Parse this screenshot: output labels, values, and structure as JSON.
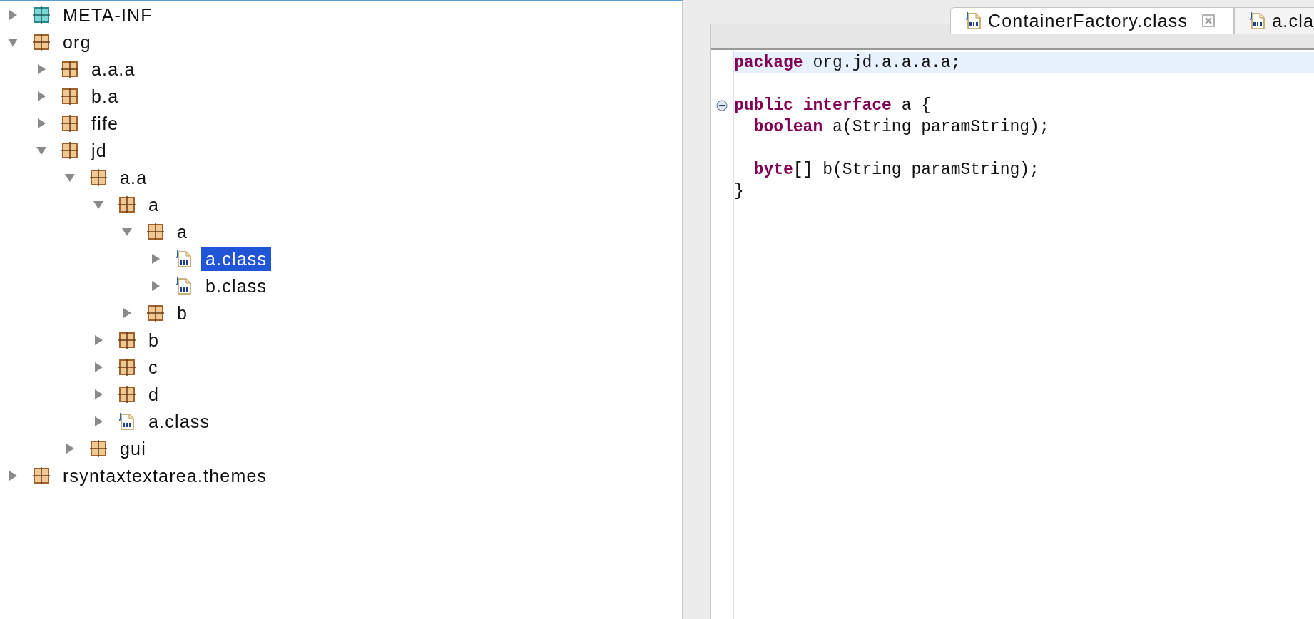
{
  "tree": [
    {
      "label": "META-INF",
      "kind": "folder",
      "expanded": false,
      "selected": false
    },
    {
      "label": "org",
      "kind": "package",
      "expanded": true,
      "selected": false,
      "children": [
        {
          "label": "a.a.a",
          "kind": "package",
          "expanded": false,
          "selected": false
        },
        {
          "label": "b.a",
          "kind": "package",
          "expanded": false,
          "selected": false
        },
        {
          "label": "fife",
          "kind": "package",
          "expanded": false,
          "selected": false
        },
        {
          "label": "jd",
          "kind": "package",
          "expanded": true,
          "selected": false,
          "children": [
            {
              "label": "a.a",
              "kind": "package",
              "expanded": true,
              "selected": false,
              "children": [
                {
                  "label": "a",
                  "kind": "package",
                  "expanded": true,
                  "selected": false,
                  "children": [
                    {
                      "label": "a",
                      "kind": "package",
                      "expanded": true,
                      "selected": false,
                      "children": [
                        {
                          "label": "a.class",
                          "kind": "class",
                          "expanded": false,
                          "selected": true
                        },
                        {
                          "label": "b.class",
                          "kind": "class",
                          "expanded": false,
                          "selected": false
                        }
                      ]
                    },
                    {
                      "label": "b",
                      "kind": "package",
                      "expanded": false,
                      "selected": false
                    }
                  ]
                },
                {
                  "label": "b",
                  "kind": "package",
                  "expanded": false,
                  "selected": false
                },
                {
                  "label": "c",
                  "kind": "package",
                  "expanded": false,
                  "selected": false
                },
                {
                  "label": "d",
                  "kind": "package",
                  "expanded": false,
                  "selected": false
                },
                {
                  "label": "a.class",
                  "kind": "class",
                  "expanded": false,
                  "selected": false
                }
              ]
            },
            {
              "label": "gui",
              "kind": "package",
              "expanded": false,
              "selected": false
            }
          ]
        }
      ]
    },
    {
      "label": "rsyntaxtextarea.themes",
      "kind": "package",
      "expanded": false,
      "selected": false
    }
  ],
  "editor_tabs": [
    {
      "label": "ContainerFactory.class",
      "selected": true
    },
    {
      "label": "a.cla",
      "selected": false
    }
  ],
  "editor": {
    "lines": [
      {
        "kind": "code",
        "tokens": [
          {
            "text": "package",
            "kind": "keyword"
          },
          {
            "text": " org.jd.a.a.a.a;",
            "kind": "plain"
          }
        ],
        "current": true
      },
      {
        "kind": "blank"
      },
      {
        "kind": "code",
        "tokens": [
          {
            "text": "public",
            "kind": "keyword"
          },
          {
            "text": " interface",
            "kind": "keyword"
          },
          {
            "text": " a {",
            "kind": "plain"
          }
        ],
        "foldable": true
      },
      {
        "kind": "code",
        "tokens": [
          {
            "text": "  boolean",
            "kind": "keyword"
          },
          {
            "text": " a(String paramString);",
            "kind": "plain"
          }
        ]
      },
      {
        "kind": "blank"
      },
      {
        "kind": "code",
        "tokens": [
          {
            "text": "  byte",
            "kind": "keyword"
          },
          {
            "text": "[] b(String paramString);",
            "kind": "plain"
          }
        ]
      },
      {
        "kind": "code",
        "tokens": [
          {
            "text": "}",
            "kind": "plain"
          }
        ]
      }
    ]
  }
}
